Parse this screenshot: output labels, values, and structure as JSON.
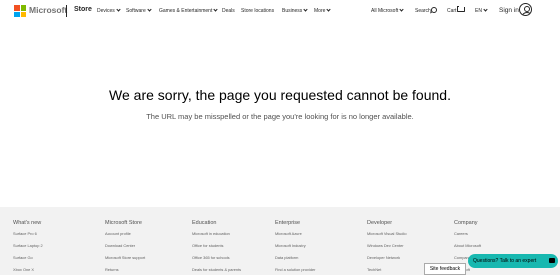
{
  "header": {
    "brand": "Microsoft",
    "store": "Store",
    "nav": [
      "Devices",
      "Software",
      "Games & Entertainment",
      "Deals",
      "Store locations",
      "Business",
      "More"
    ],
    "all_microsoft": "All Microsoft",
    "search": "Search",
    "cart": "Cart",
    "lang": "EN",
    "sign_in": "Sign in"
  },
  "main": {
    "headline": "We are sorry, the page you requested cannot be found.",
    "subtext": "The URL may be misspelled or the page you're looking for is no longer available."
  },
  "footer": {
    "columns": [
      {
        "title": "What's new",
        "links": [
          "Surface Pro 6",
          "Surface Laptop 2",
          "Surface Go",
          "Xbox One X"
        ]
      },
      {
        "title": "Microsoft Store",
        "links": [
          "Account profile",
          "Download Center",
          "Microsoft Store support",
          "Returns"
        ]
      },
      {
        "title": "Education",
        "links": [
          "Microsoft in education",
          "Office for students",
          "Office 365 for schools",
          "Deals for students & parents"
        ]
      },
      {
        "title": "Enterprise",
        "links": [
          "Microsoft Azure",
          "Microsoft Industry",
          "Data platform",
          "Find a solution provider"
        ]
      },
      {
        "title": "Developer",
        "links": [
          "Microsoft Visual Studio",
          "Windows Dev Center",
          "Developer Network",
          "TechNet"
        ]
      },
      {
        "title": "Company",
        "links": [
          "Careers",
          "About Microsoft",
          "Company news",
          "Microsoft"
        ]
      }
    ]
  },
  "widgets": {
    "site_feedback": "Site feedback",
    "chat": "Questions? Talk to an expert"
  }
}
